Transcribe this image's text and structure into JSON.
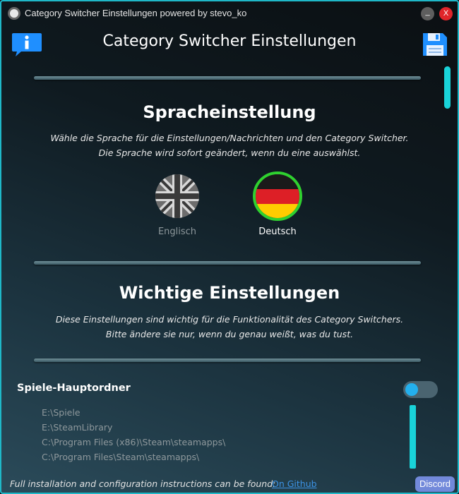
{
  "window": {
    "title": "Category Switcher Einstellungen powered by stevo_ko",
    "minimize_label": "_",
    "close_label": "X"
  },
  "header": {
    "title": "Category Switcher Einstellungen",
    "info_icon": "info-speech-bubble-icon",
    "save_icon": "floppy-disk-icon"
  },
  "language_section": {
    "title": "Spracheinstellung",
    "desc_line1": "Wähle die Sprache für die Einstellungen/Nachrichten und den Category Switcher.",
    "desc_line2": "Die Sprache wird sofort geändert, wenn du eine auswählst.",
    "options": [
      {
        "label": "Englisch",
        "icon": "uk-flag-icon",
        "selected": false
      },
      {
        "label": "Deutsch",
        "icon": "germany-flag-icon",
        "selected": true
      }
    ]
  },
  "important_section": {
    "title": "Wichtige Einstellungen",
    "desc_line1": "Diese Einstellungen sind wichtig für die Funktionalität des Category Switchers.",
    "desc_line2": "Bitte ändere sie nur, wenn du genau weißt, was du tust."
  },
  "games_folder": {
    "label": "Spiele-Hauptordner",
    "toggle_on": false,
    "paths": [
      "E:\\Spiele",
      "E:\\SteamLibrary",
      "C:\\Program Files (x86)\\Steam\\steamapps\\",
      "C:\\Program Files\\Steam\\steamapps\\"
    ]
  },
  "footer": {
    "text": "Full installation and configuration instructions can be found:",
    "link_label": "On Github",
    "discord_label": "Discord"
  },
  "colors": {
    "accent": "#19d3d9",
    "selected_ring": "#2fd12f",
    "link": "#3c93e6",
    "discord": "#7289da",
    "close": "#e0252a"
  }
}
